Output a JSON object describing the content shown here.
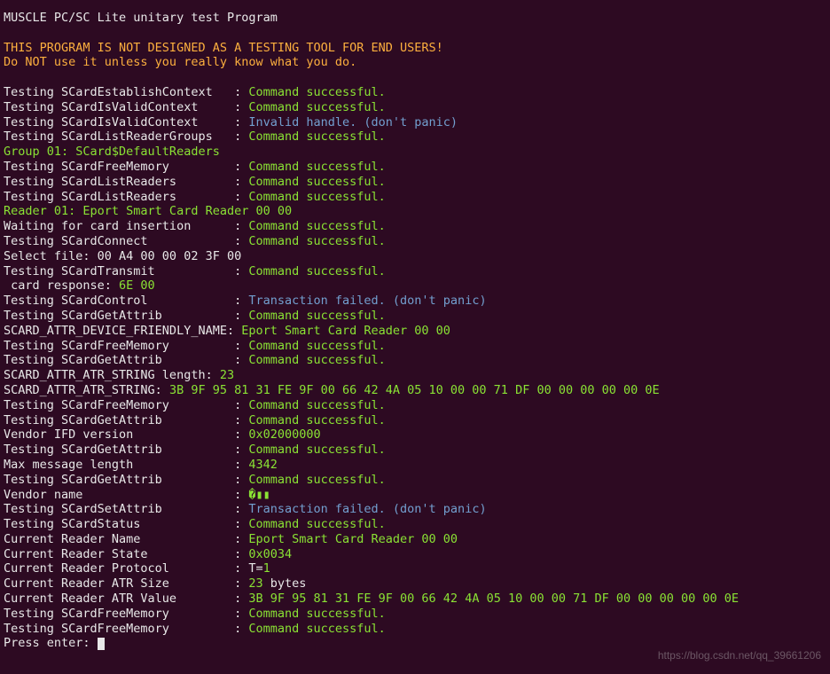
{
  "header": {
    "title": "MUSCLE PC/SC Lite unitary test Program"
  },
  "warnings": {
    "line1": "THIS PROGRAM IS NOT DESIGNED AS A TESTING TOOL FOR END USERS!",
    "line2": "Do NOT use it unless you really know what you do."
  },
  "tests": {
    "establishContext": {
      "label": "Testing SCardEstablishContext",
      "sep": "   : ",
      "result": "Command successful."
    },
    "isValidContext1": {
      "label": "Testing SCardIsValidContext",
      "sep": "     : ",
      "result": "Command successful."
    },
    "isValidContext2": {
      "label": "Testing SCardIsValidContext",
      "sep": "     : ",
      "result": "Invalid handle. (don't panic)"
    },
    "listReaderGroups": {
      "label": "Testing SCardListReaderGroups",
      "sep": "   : ",
      "result": "Command successful."
    },
    "group01": "Group 01: SCard$DefaultReaders",
    "freeMemory1": {
      "label": "Testing SCardFreeMemory",
      "sep": "         : ",
      "result": "Command successful."
    },
    "listReaders1": {
      "label": "Testing SCardListReaders",
      "sep": "        : ",
      "result": "Command successful."
    },
    "listReaders2": {
      "label": "Testing SCardListReaders",
      "sep": "        : ",
      "result": "Command successful."
    },
    "reader01": "Reader 01: Eport Smart Card Reader 00 00",
    "waitingCard": {
      "label": "Waiting for card insertion",
      "sep": "      : ",
      "result": "Command successful."
    },
    "scardConnect": {
      "label": "Testing SCardConnect",
      "sep": "            : ",
      "result": "Command successful."
    },
    "selectFile": "Select file: 00 A4 00 00 02 3F 00",
    "transmit": {
      "label": "Testing SCardTransmit",
      "sep": "           : ",
      "result": "Command successful."
    },
    "cardResponse": {
      "label": " card response: ",
      "value": "6E 00"
    },
    "scardControl": {
      "label": "Testing SCardControl",
      "sep": "            : ",
      "result": "Transaction failed. (don't panic)"
    },
    "getAttrib1": {
      "label": "Testing SCardGetAttrib",
      "sep": "          : ",
      "result": "Command successful."
    },
    "friendlyName": {
      "label": "SCARD_ATTR_DEVICE_FRIENDLY_NAME: ",
      "value": "Eport Smart Card Reader 00 00"
    },
    "freeMemory2": {
      "label": "Testing SCardFreeMemory",
      "sep": "         : ",
      "result": "Command successful."
    },
    "getAttrib2": {
      "label": "Testing SCardGetAttrib",
      "sep": "          : ",
      "result": "Command successful."
    },
    "atrStringLen": {
      "label": "SCARD_ATTR_ATR_STRING length: ",
      "value": "23"
    },
    "atrString": {
      "label": "SCARD_ATTR_ATR_STRING: ",
      "value": "3B 9F 95 81 31 FE 9F 00 66 42 4A 05 10 00 00 71 DF 00 00 00 00 00 0E"
    },
    "freeMemory3": {
      "label": "Testing SCardFreeMemory",
      "sep": "         : ",
      "result": "Command successful."
    },
    "getAttrib3": {
      "label": "Testing SCardGetAttrib",
      "sep": "          : ",
      "result": "Command successful."
    },
    "vendorIfd": {
      "label": "Vendor IFD version",
      "sep": "              : ",
      "value": "0x02000000"
    },
    "getAttrib4": {
      "label": "Testing SCardGetAttrib",
      "sep": "          : ",
      "result": "Command successful."
    },
    "maxMsgLen": {
      "label": "Max message length",
      "sep": "              : ",
      "value": "4342"
    },
    "getAttrib5": {
      "label": "Testing SCardGetAttrib",
      "sep": "          : ",
      "result": "Command successful."
    },
    "vendorName": {
      "label": "Vendor name",
      "sep": "                     : "
    },
    "setAttrib": {
      "label": "Testing SCardSetAttrib",
      "sep": "          : ",
      "result": "Transaction failed. (don't panic)"
    },
    "scardStatus": {
      "label": "Testing SCardStatus",
      "sep": "             : ",
      "result": "Command successful."
    },
    "curReaderName": {
      "label": "Current Reader Name",
      "sep": "             : ",
      "value": "Eport Smart Card Reader 00 00"
    },
    "curReaderState": {
      "label": "Current Reader State",
      "sep": "            : ",
      "value": "0x0034"
    },
    "curReaderProto": {
      "label": "Current Reader Protocol",
      "sep": "         : ",
      "prefix": "T=",
      "value": "1"
    },
    "curReaderAtrSize": {
      "label": "Current Reader ATR Size",
      "sep": "         : ",
      "value": "23",
      "suffix": " bytes"
    },
    "curReaderAtrVal": {
      "label": "Current Reader ATR Value",
      "sep": "        : ",
      "value": "3B 9F 95 81 31 FE 9F 00 66 42 4A 05 10 00 00 71 DF 00 00 00 00 00 0E"
    },
    "freeMemory4": {
      "label": "Testing SCardFreeMemory",
      "sep": "         : ",
      "result": "Command successful."
    },
    "freeMemory5": {
      "label": "Testing SCardFreeMemory",
      "sep": "         : ",
      "result": "Command successful."
    }
  },
  "prompt": "Press enter: ",
  "watermark": "https://blog.csdn.net/qq_39661206"
}
